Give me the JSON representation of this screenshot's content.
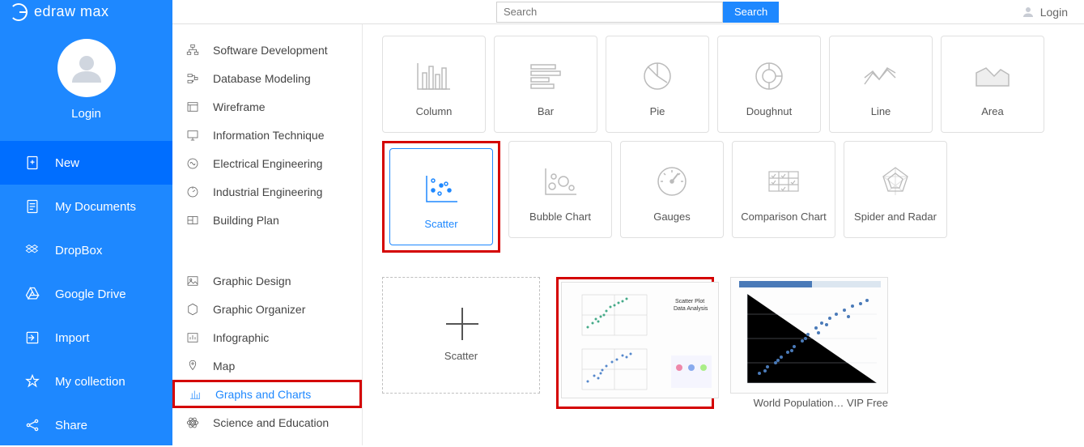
{
  "brand": "edraw max",
  "search": {
    "placeholder": "Search",
    "button": "Search"
  },
  "top_login": "Login",
  "sidebar": {
    "login": "Login",
    "items": [
      {
        "label": "New",
        "active": true
      },
      {
        "label": "My Documents"
      },
      {
        "label": "DropBox"
      },
      {
        "label": "Google Drive"
      },
      {
        "label": "Import"
      },
      {
        "label": "My collection"
      },
      {
        "label": "Share"
      }
    ]
  },
  "categories_a": [
    "Software Development",
    "Database Modeling",
    "Wireframe",
    "Information Technique",
    "Electrical Engineering",
    "Industrial Engineering",
    "Building Plan"
  ],
  "categories_b": [
    "Graphic Design",
    "Graphic Organizer",
    "Infographic",
    "Map",
    "Graphs and Charts",
    "Science and Education"
  ],
  "chart_types": [
    "Column",
    "Bar",
    "Pie",
    "Doughnut",
    "Line",
    "Area",
    "Scatter",
    "Bubble Chart",
    "Gauges",
    "Comparison Chart",
    "Spider and Radar"
  ],
  "selected_chart": "Scatter",
  "templates": [
    {
      "label": "Scatter",
      "kind": "blank"
    },
    {
      "label": "",
      "kind": "preview"
    },
    {
      "label": "World Population…   VIP Free",
      "kind": "preview"
    }
  ]
}
